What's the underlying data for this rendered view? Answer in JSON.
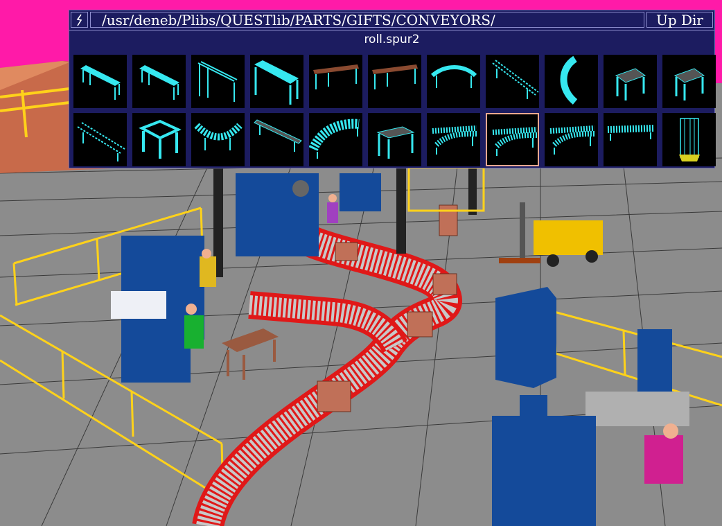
{
  "browser": {
    "path": "/usr/deneb/Plibs/QUESTlib/PARTS/GIFTS/CONVEYORS/",
    "up_dir_label": "Up Dir",
    "bolt_icon": "lightning-icon",
    "selected_name": "roll.spur2",
    "selected_index": 18,
    "thumbnails": [
      {
        "icon": "straight-belt-conveyor-icon"
      },
      {
        "icon": "straight-belt-conveyor-icon"
      },
      {
        "icon": "roller-conveyor-tall-icon"
      },
      {
        "icon": "flat-belt-table-icon"
      },
      {
        "icon": "wood-top-conveyor-icon"
      },
      {
        "icon": "wood-top-conveyor-icon"
      },
      {
        "icon": "curved-conveyor-icon"
      },
      {
        "icon": "long-roller-conveyor-icon"
      },
      {
        "icon": "curved-chute-icon"
      },
      {
        "icon": "short-roller-section-icon"
      },
      {
        "icon": "short-roller-section-icon"
      },
      {
        "icon": "roller-conveyor-icon"
      },
      {
        "icon": "transfer-table-icon"
      },
      {
        "icon": "curved-roller-conveyor-icon"
      },
      {
        "icon": "long-belt-conveyor-icon"
      },
      {
        "icon": "wide-curved-roller-icon"
      },
      {
        "icon": "roller-stand-icon"
      },
      {
        "icon": "roller-spur-icon"
      },
      {
        "icon": "roller-spur-icon"
      },
      {
        "icon": "roller-spur-icon"
      },
      {
        "icon": "straight-roller-icon"
      },
      {
        "icon": "cage-lift-icon"
      }
    ]
  },
  "colors": {
    "background_pink": "#ff1aa8",
    "panel": "#1c1c60",
    "thumb_line": "#36e8f0",
    "selection": "#f0a890",
    "conveyor_frame": "#e01818",
    "rollers": "#c8c8c8",
    "machine_blue": "#144a9a",
    "railing": "#ffd21a"
  }
}
